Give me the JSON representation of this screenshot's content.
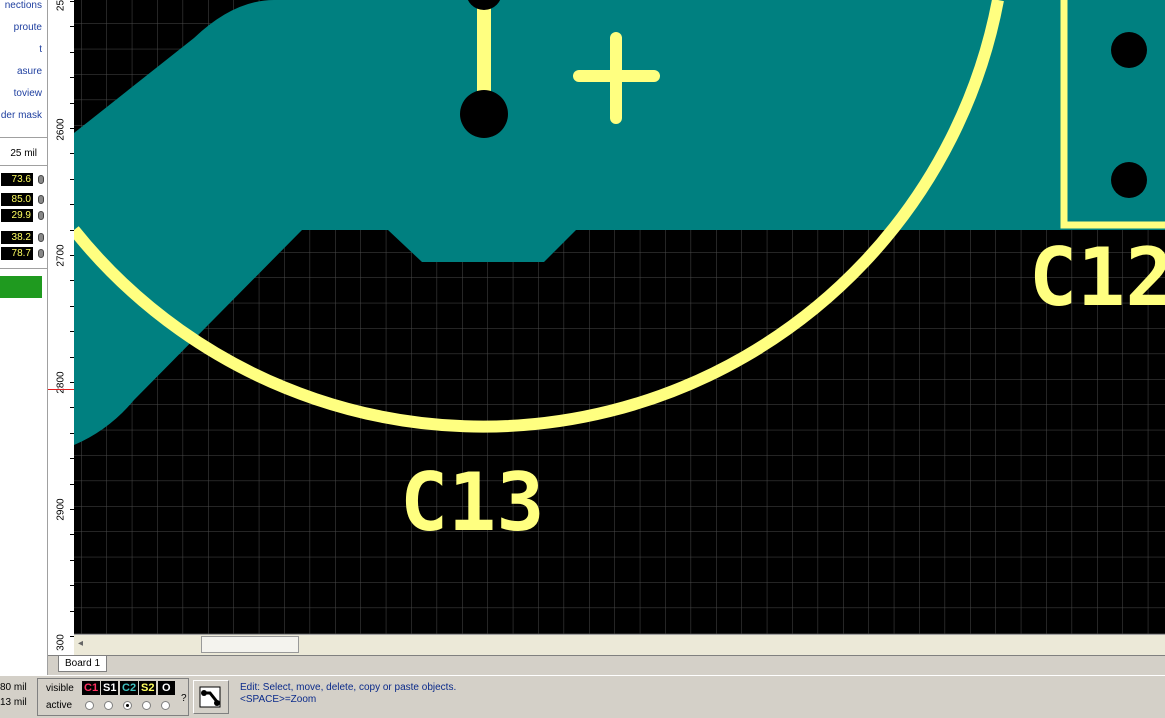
{
  "left_panel": {
    "menu_items": [
      "nections",
      "proute",
      "t",
      "asure",
      "toview",
      "der mask"
    ],
    "grid_label": "25 mil",
    "values": [
      "73.6",
      "85.0",
      "29.9",
      "38.2",
      "78.7"
    ],
    "swatch_color": "#1f9a1f"
  },
  "ruler": {
    "labels": [
      "25",
      "2600",
      "2700",
      "2800",
      "2900",
      "300"
    ]
  },
  "canvas": {
    "background": "#000000",
    "copper_color": "#008080",
    "silk_color": "#ffff80",
    "labels": {
      "c13": "C13",
      "c12": "C12"
    }
  },
  "tabs": [
    "Board 1"
  ],
  "status": {
    "coord_x": "80 mil",
    "coord_y": "13 mil",
    "visible_label": "visible",
    "active_label": "active",
    "layers": [
      {
        "name": "C1",
        "color": "#ff3060"
      },
      {
        "name": "S1",
        "color": "#ffffff"
      },
      {
        "name": "C2",
        "color": "#40c0c0"
      },
      {
        "name": "S2",
        "color": "#ffff60"
      },
      {
        "name": "O",
        "color": "#ffffff"
      }
    ],
    "help": "?",
    "message_line1": "Edit: Select, move, delete, copy or paste objects.",
    "message_line2": "<SPACE>=Zoom"
  }
}
